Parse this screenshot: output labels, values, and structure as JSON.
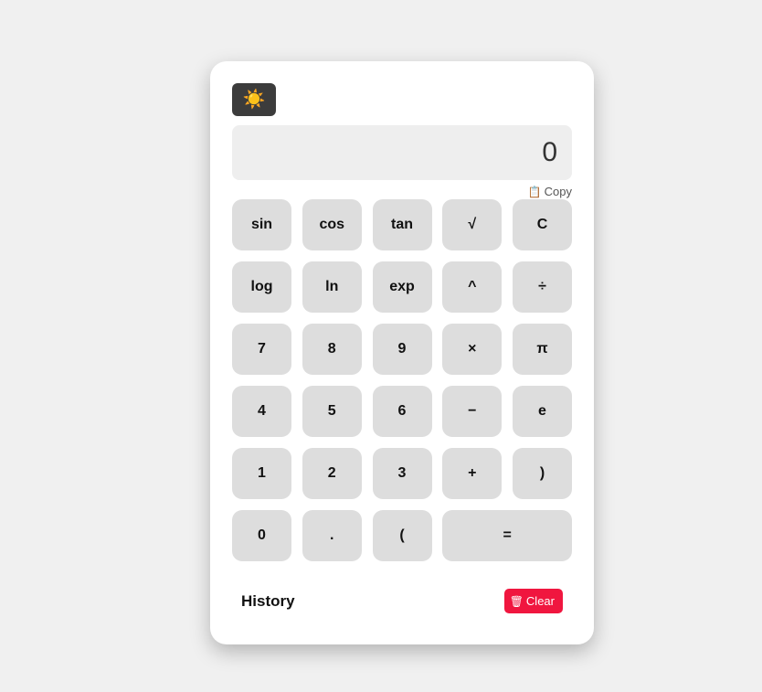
{
  "theme_toggle": {
    "icon": "sun-icon",
    "glyph": "☀️"
  },
  "display": {
    "value": "0"
  },
  "copy": {
    "icon": "clipboard-icon",
    "glyph": "📋",
    "label": "Copy"
  },
  "keys": [
    {
      "name": "key-sin",
      "label": "sin"
    },
    {
      "name": "key-cos",
      "label": "cos"
    },
    {
      "name": "key-tan",
      "label": "tan"
    },
    {
      "name": "key-sqrt",
      "label": "√"
    },
    {
      "name": "key-clear",
      "label": "C"
    },
    {
      "name": "key-log",
      "label": "log"
    },
    {
      "name": "key-ln",
      "label": "ln"
    },
    {
      "name": "key-exp",
      "label": "exp"
    },
    {
      "name": "key-power",
      "label": "^"
    },
    {
      "name": "key-divide",
      "label": "÷"
    },
    {
      "name": "key-7",
      "label": "7"
    },
    {
      "name": "key-8",
      "label": "8"
    },
    {
      "name": "key-9",
      "label": "9"
    },
    {
      "name": "key-multiply",
      "label": "×"
    },
    {
      "name": "key-pi",
      "label": "π"
    },
    {
      "name": "key-4",
      "label": "4"
    },
    {
      "name": "key-5",
      "label": "5"
    },
    {
      "name": "key-6",
      "label": "6"
    },
    {
      "name": "key-minus",
      "label": "−"
    },
    {
      "name": "key-e",
      "label": "e"
    },
    {
      "name": "key-1",
      "label": "1"
    },
    {
      "name": "key-2",
      "label": "2"
    },
    {
      "name": "key-3",
      "label": "3"
    },
    {
      "name": "key-plus",
      "label": "+"
    },
    {
      "name": "key-close-paren",
      "label": ")"
    },
    {
      "name": "key-0",
      "label": "0"
    },
    {
      "name": "key-decimal",
      "label": "."
    },
    {
      "name": "key-open-paren",
      "label": "("
    },
    {
      "name": "key-equals",
      "label": "=",
      "wide": true
    }
  ],
  "history": {
    "title": "History",
    "clear_label": "Clear",
    "clear_icon": "trash-icon",
    "clear_glyph": "🗑"
  },
  "colors": {
    "background": "#f0f0f0",
    "card": "#ffffff",
    "key": "#dddddd",
    "display": "#eeeeee",
    "theme_button": "#3c3c3c",
    "clear_button": "#f0163f"
  }
}
